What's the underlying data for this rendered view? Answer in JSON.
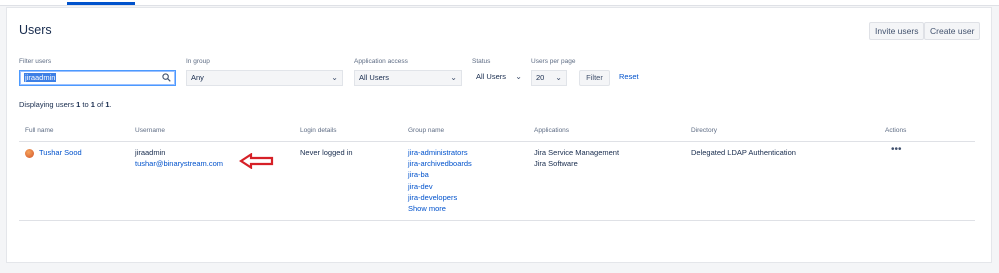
{
  "page": {
    "title": "Users"
  },
  "header_actions": {
    "invite_users": "Invite users",
    "create_user": "Create user"
  },
  "filters": {
    "filter_users": {
      "label": "Filter users",
      "value": "jiraadmin"
    },
    "in_group": {
      "label": "In group",
      "value": "Any"
    },
    "application_access": {
      "label": "Application access",
      "value": "All Users"
    },
    "status": {
      "label": "Status",
      "value": "All Users"
    },
    "users_per_page": {
      "label": "Users per page",
      "value": "20"
    },
    "filter_button": "Filter",
    "reset_link": "Reset"
  },
  "displaying": {
    "prefix": "Displaying users ",
    "from": "1",
    "mid1": " to ",
    "to": "1",
    "mid2": " of ",
    "total": "1",
    "suffix": "."
  },
  "table": {
    "headers": {
      "full_name": "Full name",
      "username": "Username",
      "login_details": "Login details",
      "group_name": "Group name",
      "applications": "Applications",
      "directory": "Directory",
      "actions": "Actions"
    },
    "rows": [
      {
        "full_name": "Tushar Sood",
        "username": "jiraadmin",
        "email": "tushar@binarystream.com",
        "login_details": "Never logged in",
        "groups": [
          "jira-administrators",
          "jira-archivedboards",
          "jira-ba",
          "jira-dev",
          "jira-developers"
        ],
        "show_more": "Show more",
        "applications": [
          "Jira Service Management",
          "Jira Software"
        ],
        "directory": "Delegated LDAP Authentication",
        "actions_icon": "more-icon"
      }
    ]
  },
  "colors": {
    "link": "#0052cc",
    "annotation_arrow": "#d62027",
    "focus_border": "#4c9aff"
  }
}
